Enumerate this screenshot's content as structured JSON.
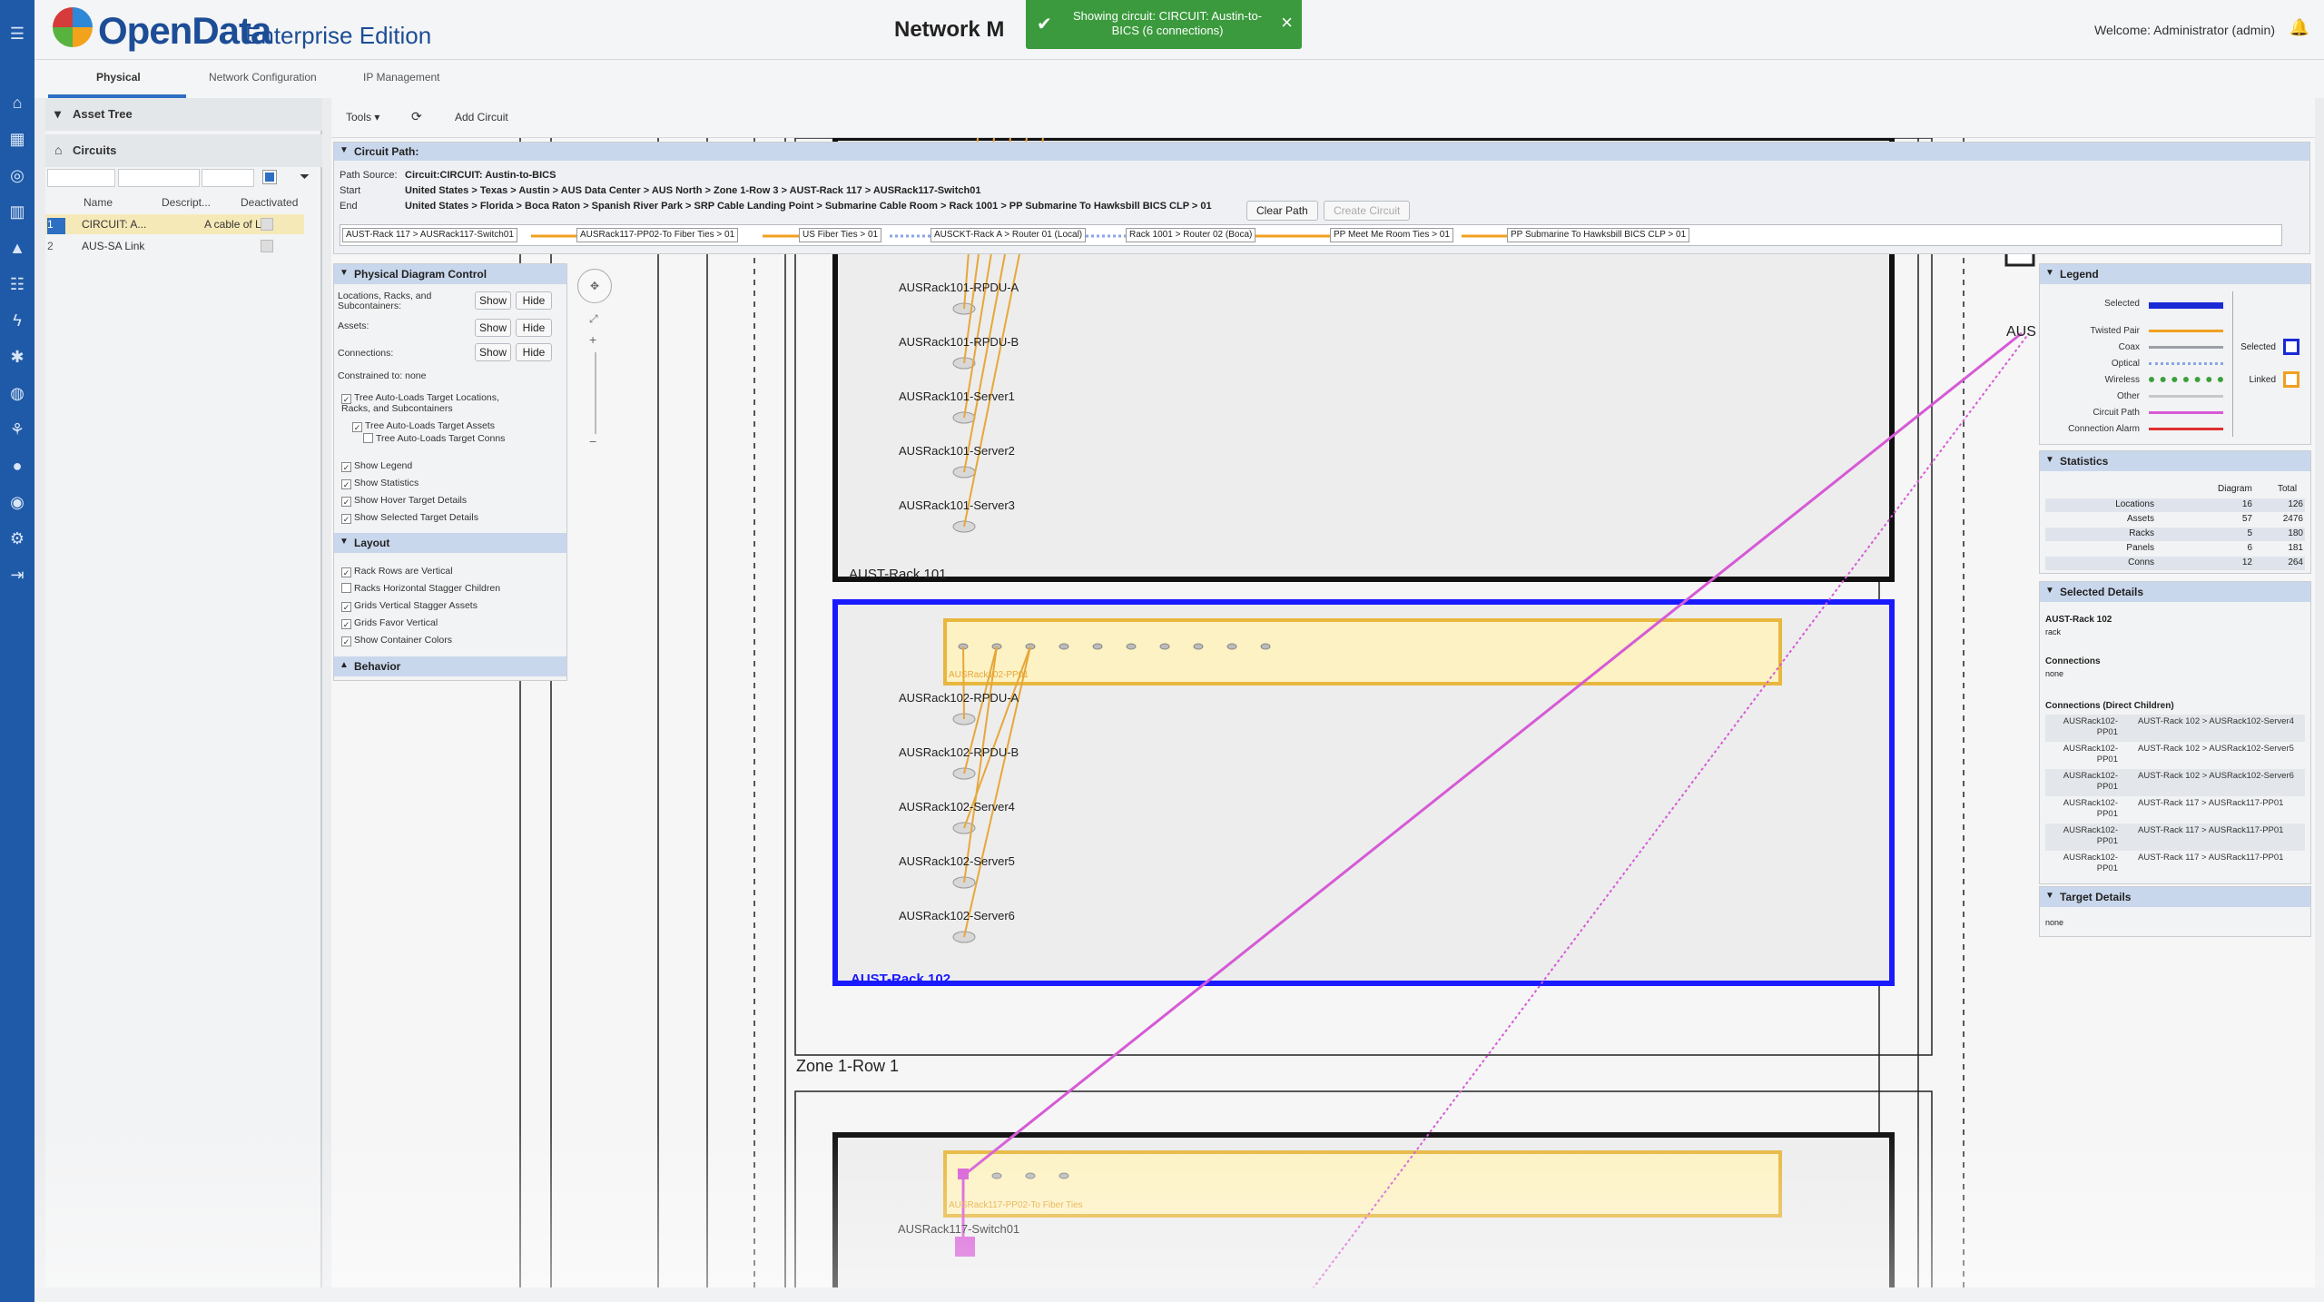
{
  "app": {
    "logo_main": "OpenData",
    "logo_edition": "Enterprise Edition",
    "page_title": "Network M",
    "welcome": "Welcome: Administrator (admin)",
    "brand_color": "#1f5aa8"
  },
  "toast": {
    "message": "Showing circuit: CIRCUIT: Austin-to-BICS (6 connections)",
    "color": "#3b9a3d"
  },
  "tabs": [
    "Physical",
    "Network Configuration",
    "IP Management"
  ],
  "asset_tree": {
    "title": "Asset Tree",
    "circuits_label": "Circuits",
    "columns": [
      "Name",
      "Descript...",
      "Deactivated"
    ],
    "rows": [
      {
        "num": "1",
        "name": "CIRCUIT: A...",
        "desc": "A cable of Li..."
      },
      {
        "num": "2",
        "name": "AUS-SA Link",
        "desc": ""
      }
    ]
  },
  "toolbar": {
    "tools": "Tools",
    "add_circuit": "Add Circuit"
  },
  "circuit_path": {
    "title": "Circuit Path:",
    "source_label": "Path Source:",
    "source": "Circuit:CIRCUIT: Austin-to-BICS",
    "start_label": "Start",
    "start": "United States > Texas > Austin > AUS Data Center > AUS North > Zone 1-Row 3 > AUST-Rack 117 > AUSRack117-Switch01",
    "end_label": "End",
    "end": "United States > Florida > Boca Raton > Spanish River Park > SRP Cable Landing Point > Submarine Cable Room > Rack 1001 > PP Submarine To Hawksbill BICS CLP > 01",
    "clear_path": "Clear Path",
    "create_circuit": "Create Circuit",
    "segments": [
      "AUST-Rack 117 > AUSRack117-Switch01",
      "AUSRack117-PP02-To Fiber Ties > 01",
      "US Fiber Ties > 01",
      "AUSCKT-Rack A > Router 01 (Local)",
      "Rack 1001 > Router 02 (Boca)",
      "PP Meet Me Room Ties > 01",
      "PP Submarine To Hawksbill BICS CLP > 01"
    ]
  },
  "diagram_control": {
    "title": "Physical Diagram Control",
    "rows": [
      {
        "label": "Locations, Racks, and Subcontainers:",
        "show": "Show",
        "hide": "Hide"
      },
      {
        "label": "Assets:",
        "show": "Show",
        "hide": "Hide"
      },
      {
        "label": "Connections:",
        "show": "Show",
        "hide": "Hide"
      }
    ],
    "constrained": "Constrained to: none",
    "checks": [
      {
        "label": "Tree Auto-Loads Target Locations, Racks, and Subcontainers",
        "checked": true
      },
      {
        "label": "Tree Auto-Loads Target Assets",
        "checked": true
      },
      {
        "label": "Tree Auto-Loads Target Conns",
        "checked": false
      },
      {
        "label": "Show Legend",
        "checked": true
      },
      {
        "label": "Show Statistics",
        "checked": true
      },
      {
        "label": "Show Hover Target Details",
        "checked": true
      },
      {
        "label": "Show Selected Target Details",
        "checked": true
      }
    ],
    "layout_title": "Layout",
    "layout_checks": [
      {
        "label": "Rack Rows are Vertical",
        "checked": true
      },
      {
        "label": "Racks Horizontal Stagger Children",
        "checked": false
      },
      {
        "label": "Grids Vertical Stagger Assets",
        "checked": true
      },
      {
        "label": "Grids Favor Vertical",
        "checked": true
      },
      {
        "label": "Show Container Colors",
        "checked": true
      }
    ],
    "behavior_title": "Behavior"
  },
  "diagram": {
    "rack101_label": "AUST-Rack 101",
    "rack101_assets": [
      "AUSRack101-RPDU-A",
      "AUSRack101-RPDU-B",
      "AUSRack101-Server1",
      "AUSRack101-Server2",
      "AUSRack101-Server3"
    ],
    "rack102_label": "AUST-Rack 102",
    "rack102_panel": "AUSRack102-PP01",
    "rack102_assets": [
      "AUSRack102-RPDU-A",
      "AUSRack102-RPDU-B",
      "AUSRack102-Server4",
      "AUSRack102-Server5",
      "AUSRack102-Server6"
    ],
    "zone_label": "Zone 1-Row 1",
    "rack117_panel": "AUSRack117-PP02-To Fiber Ties",
    "rack117_switch": "AUSRack117-Switch01",
    "offscreen_label": "AUS",
    "colors": {
      "selected": "#1a1aff",
      "circuit": "#d65ad6",
      "panel": "#e7b73e"
    }
  },
  "legend": {
    "title": "Legend",
    "items": [
      {
        "label": "Selected",
        "color": "#1a2bd6"
      },
      {
        "label": "Twisted Pair",
        "color": "#f0a020"
      },
      {
        "label": "Coax",
        "color": "#9aa0a6"
      },
      {
        "label": "Optical",
        "color": "#8aa6e6"
      },
      {
        "label": "Wireless",
        "color": "#3aa03a"
      },
      {
        "label": "Other",
        "color": "#c8c8c8"
      },
      {
        "label": "Circuit Path",
        "color": "#d65ad6"
      },
      {
        "label": "Connection Alarm",
        "color": "#e03030"
      }
    ],
    "selected_box": "Selected",
    "linked_box": "Linked"
  },
  "statistics": {
    "title": "Statistics",
    "col_diagram": "Diagram",
    "col_total": "Total",
    "rows": [
      {
        "label": "Locations",
        "diagram": "16",
        "total": "126"
      },
      {
        "label": "Assets",
        "diagram": "57",
        "total": "2476"
      },
      {
        "label": "Racks",
        "diagram": "5",
        "total": "180"
      },
      {
        "label": "Panels",
        "diagram": "6",
        "total": "181"
      },
      {
        "label": "Conns",
        "diagram": "12",
        "total": "264"
      }
    ]
  },
  "selected_details": {
    "title": "Selected Details",
    "name": "AUST-Rack 102",
    "type": "rack",
    "connections_label": "Connections",
    "connections_value": "none",
    "direct_label": "Connections (Direct Children)",
    "rows": [
      {
        "a": "AUSRack102-PP01",
        "b": "AUST-Rack 102 > AUSRack102-Server4"
      },
      {
        "a": "AUSRack102-PP01",
        "b": "AUST-Rack 102 > AUSRack102-Server5"
      },
      {
        "a": "AUSRack102-PP01",
        "b": "AUST-Rack 102 > AUSRack102-Server6"
      },
      {
        "a": "AUSRack102-PP01",
        "b": "AUST-Rack 117 > AUSRack117-PP01"
      },
      {
        "a": "AUSRack102-PP01",
        "b": "AUST-Rack 117 > AUSRack117-PP01"
      },
      {
        "a": "AUSRack102-PP01",
        "b": "AUST-Rack 117 > AUSRack117-PP01"
      }
    ]
  },
  "target_details": {
    "title": "Target Details",
    "value": "none"
  }
}
